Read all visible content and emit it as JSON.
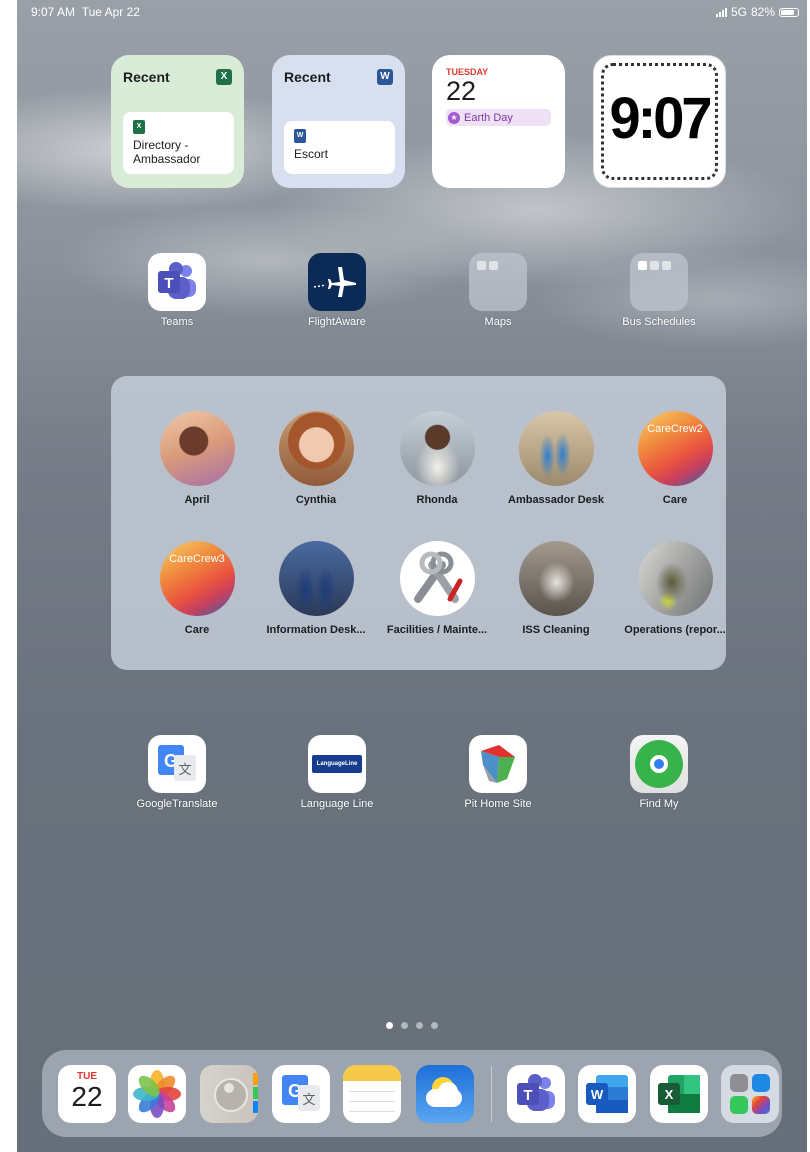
{
  "status_bar": {
    "time": "9:07 AM",
    "date": "Tue Apr 22",
    "network": "5G",
    "battery": "82%",
    "battery_level": 0.82
  },
  "widgets": {
    "excel_recent": {
      "title": "Recent",
      "app_badge": "X",
      "file_badge": "X",
      "file_name": "Directory - Ambassador"
    },
    "word_recent": {
      "title": "Recent",
      "app_badge": "W",
      "file_badge": "W",
      "file_name": "Escort"
    },
    "calendar": {
      "weekday": "TUESDAY",
      "day": "22",
      "event": "Earth Day"
    },
    "clock": {
      "time": "9:07"
    }
  },
  "apps_row1": [
    {
      "label": "Teams",
      "icon": "teams-icon"
    },
    {
      "label": "FlightAware",
      "icon": "flightaware-icon"
    },
    {
      "label": "Maps",
      "icon": "folder-icon"
    },
    {
      "label": "Bus Schedules",
      "icon": "folder-icon"
    }
  ],
  "contacts": [
    {
      "name": "April",
      "avatar": "photo"
    },
    {
      "name": "Cynthia",
      "avatar": "photo"
    },
    {
      "name": "Rhonda",
      "avatar": "photo"
    },
    {
      "name": "Ambassador Desk",
      "avatar": "photo"
    },
    {
      "name": "Care",
      "avatar": "CareCrew2"
    },
    {
      "name": "Care",
      "avatar": "CareCrew3"
    },
    {
      "name": "Information Desk...",
      "avatar": "photo"
    },
    {
      "name": "Facilities / Mainte...",
      "avatar": "photo"
    },
    {
      "name": "ISS Cleaning",
      "avatar": "photo"
    },
    {
      "name": "Operations (repor...",
      "avatar": "photo"
    }
  ],
  "crew_labels": {
    "crew2": "CareCrew2",
    "crew3": "CareCrew3"
  },
  "apps_row2": [
    {
      "label": "GoogleTranslate",
      "icon": "google-translate-icon"
    },
    {
      "label": "Language Line",
      "icon": "language-line-icon"
    },
    {
      "label": "Pit Home Site",
      "icon": "pit-home-site-icon"
    },
    {
      "label": "Find My",
      "icon": "find-my-icon"
    }
  ],
  "language_line_logo": "LanguageLine",
  "page_indicator": {
    "pages": 4,
    "current": 1
  },
  "dock": {
    "calendar_month": "TUE",
    "calendar_day": "22",
    "apps": [
      "calendar",
      "photos",
      "contacts",
      "google-translate",
      "notes",
      "weather",
      "teams",
      "word",
      "excel",
      "app-library"
    ]
  },
  "colors": {
    "excel_green": "#1e7145",
    "word_blue": "#2b579a",
    "teams_purple": "#5b5fc7",
    "calendar_red": "#e0382f"
  }
}
